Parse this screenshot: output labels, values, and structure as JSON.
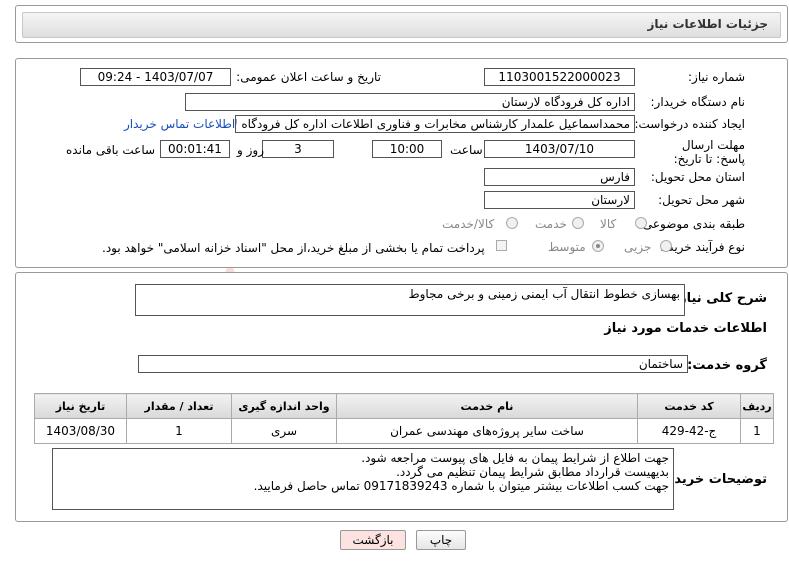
{
  "header": {
    "title": "جزئیات اطلاعات نیاز"
  },
  "need_number": {
    "label": "شماره نیاز:",
    "value": "1103001522000023"
  },
  "announce": {
    "label": "تاریخ و ساعت اعلان عمومی:",
    "value": "1403/07/07 - 09:24"
  },
  "buyer_org": {
    "label": "نام دستگاه خریدار:",
    "value": "اداره کل فرودگاه لارستان"
  },
  "requester": {
    "label": "ایجاد کننده درخواست:",
    "value": "محمداسماعیل علمدار کارشناس مخابرات و فناوری اطلاعات اداره کل فرودگاه لارستان",
    "contact_link": "اطلاعات تماس خریدار"
  },
  "deadline": {
    "label": "مهلت ارسال پاسخ: تا تاریخ:",
    "date": "1403/07/10",
    "time_label": "ساعت",
    "time": "10:00",
    "days": "3",
    "days_label": "روز و",
    "remaining": "00:01:41",
    "remaining_label": "ساعت باقی مانده"
  },
  "province": {
    "label": "استان محل تحویل:",
    "value": "فارس"
  },
  "city": {
    "label": "شهر محل تحویل:",
    "value": "لارستان"
  },
  "category": {
    "label": "طبقه بندی موضوعی:",
    "options": [
      "کالا",
      "خدمت",
      "کالا/خدمت"
    ]
  },
  "process": {
    "label": "نوع فرآیند خرید :",
    "options": [
      "جزیی",
      "متوسط"
    ],
    "payment_note": "پرداخت تمام یا بخشی از مبلغ خرید،از محل \"اسناد خزانه اسلامی\" خواهد بود."
  },
  "summary": {
    "label": "شرح کلی نیاز:",
    "value": "بهسازی خطوط انتقال آب ایمنی زمینی و برخی مجاوط"
  },
  "services_title": "اطلاعات خدمات مورد نیاز",
  "service_group": {
    "label": "گروه خدمت:",
    "value": "ساختمان"
  },
  "table": {
    "headers": {
      "row": "ردیف",
      "code": "کد خدمت",
      "name": "نام خدمت",
      "unit": "واحد اندازه گیری",
      "qty": "تعداد / مقدار",
      "date": "تاریخ نیاز"
    },
    "rows": [
      {
        "row": "1",
        "code": "ج-42-429",
        "name": "ساخت سایر پروژه‌های مهندسی عمران",
        "unit": "سری",
        "qty": "1",
        "date": "1403/08/30"
      }
    ]
  },
  "buyer_notes": {
    "label": "توضیحات خریدار:",
    "lines": [
      "جهت اطلاع از شرایط پیمان به فایل های پیوست مراجعه شود.",
      "بدیهیست قرارداد مطابق شرایط پیمان تنظیم می گردد.",
      "جهت کسب اطلاعات بیشتر میتوان با شماره 09171839243 تماس حاصل فرمایید."
    ]
  },
  "buttons": {
    "print": "چاپ",
    "back": "بازگشت"
  },
  "watermark": "AriaTender.neT",
  "colors": {
    "link": "#1a4fb8",
    "back_button_bg": "#fde2e2",
    "watermark": "#c0392b"
  }
}
